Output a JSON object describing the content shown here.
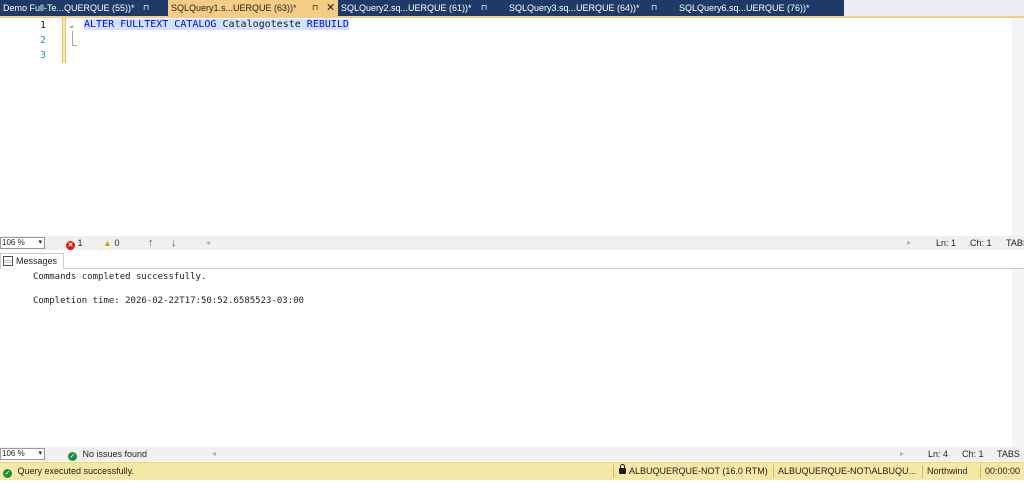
{
  "tabs": [
    {
      "title": "Demo Full-Te...QUERQUE (55))*",
      "pin": "⊓"
    },
    {
      "title": "SQLQuery1.s...UERQUE (63))*",
      "pin": "⊓",
      "close": "✕"
    },
    {
      "title": "SQLQuery2.sq...UERQUE (61))*",
      "pin": "⊓"
    },
    {
      "title": "SQLQuery3.sq...UERQUE (64))*",
      "pin": "⊓"
    },
    {
      "title": "SQLQuery6.sq...UERQUE (76))*"
    }
  ],
  "editor": {
    "line_numbers": [
      "1",
      "2",
      "3"
    ],
    "code": {
      "kw1": "ALTER FULLTEXT CATALOG",
      "name": "Catalogoteste",
      "kw2": "REBUILD"
    }
  },
  "editor_status": {
    "zoom": "106 %",
    "errors": "1",
    "warnings": "0",
    "ln": "Ln: 1",
    "ch": "Ch: 1",
    "mode": "TABS"
  },
  "results": {
    "tab_label": "Messages",
    "lines": [
      "Commands completed successfully.",
      "Completion time: 2026-02-22T17:50:52.6585523-03:00"
    ]
  },
  "results_status": {
    "zoom": "106 %",
    "issues": "No issues found",
    "ln": "Ln: 4",
    "ch": "Ch: 1",
    "mode": "TABS"
  },
  "statusbar": {
    "message": "Query executed successfully.",
    "server": "ALBUQUERQUE-NOT (16.0 RTM)",
    "login": "ALBUQUERQUE-NOT\\ALBUQU...",
    "database": "Northwind",
    "elapsed": "00:00:00"
  },
  "colors": {
    "accent_tab": "#f5cc84",
    "dark_tab": "#1f3a66",
    "status_yellow": "#f4e8a6",
    "keyword": "#0000ff"
  }
}
